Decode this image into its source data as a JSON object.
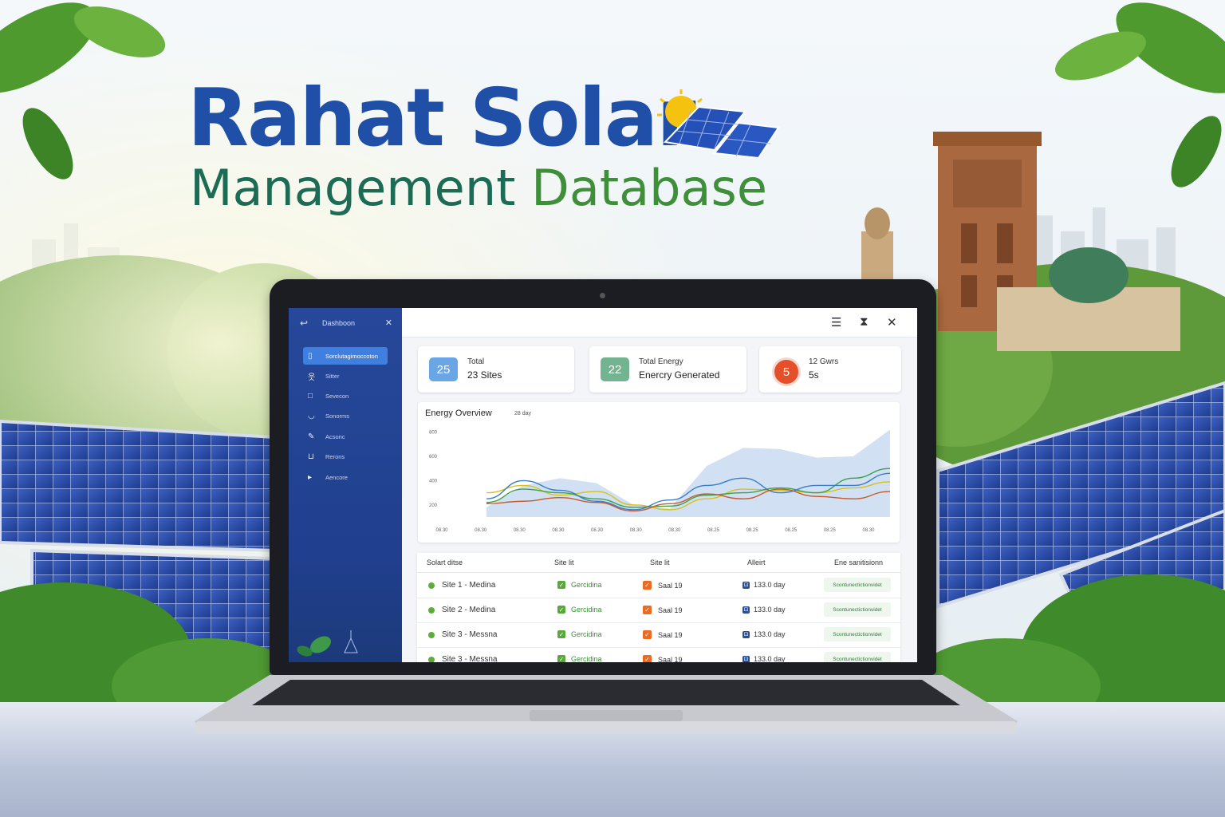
{
  "header": {
    "title_line1": "Rahat Solar",
    "title_line2_part1": "Management",
    "title_line2_part2": "Database"
  },
  "sidebar": {
    "app_name": "Dashboon",
    "items": [
      {
        "label": "Sorclutagimoccoton",
        "icon": "dashboard-icon",
        "active": true
      },
      {
        "label": "Sitter",
        "icon": "user-icon"
      },
      {
        "label": "Sevecon",
        "icon": "square-icon"
      },
      {
        "label": "Sonorms",
        "icon": "shield-icon"
      },
      {
        "label": "Acsonc",
        "icon": "edit-icon"
      },
      {
        "label": "Rerons",
        "icon": "document-icon"
      },
      {
        "label": "Aencore",
        "icon": "play-icon"
      }
    ]
  },
  "cards": [
    {
      "number": "25",
      "line1": "Total",
      "line2": "23 Sites",
      "color": "#6aa6e6"
    },
    {
      "number": "22",
      "line1": "Total Energy",
      "line2": "Enercry Generated",
      "color": "#74b38f"
    },
    {
      "number": "5",
      "line1": "12 Gwrs",
      "line2": "5s",
      "color": "#e5502a"
    }
  ],
  "chart_panel": {
    "title": "Energy Overview",
    "subtitle": "28 day"
  },
  "chart_data": {
    "type": "line",
    "x": [
      "08.30",
      "08.30",
      "08.30",
      "08.30",
      "08.30",
      "08.30",
      "08.30",
      "08.25",
      "08.25",
      "08.25",
      "08.25",
      "08.30"
    ],
    "y_ticks": [
      200,
      400,
      600,
      800
    ],
    "ylim": [
      100,
      850
    ],
    "area": [
      180,
      360,
      420,
      380,
      200,
      170,
      520,
      670,
      660,
      590,
      600,
      820
    ],
    "series": [
      {
        "color": "#d7c11c",
        "values": [
          300,
          360,
          280,
          310,
          200,
          160,
          250,
          330,
          320,
          300,
          340,
          390
        ]
      },
      {
        "color": "#3aa24a",
        "values": [
          220,
          330,
          300,
          250,
          180,
          190,
          280,
          300,
          340,
          300,
          420,
          500
        ]
      },
      {
        "color": "#3a7ec9",
        "values": [
          250,
          400,
          320,
          230,
          160,
          240,
          360,
          420,
          300,
          360,
          360,
          460
        ]
      },
      {
        "color": "#c45a2e",
        "values": [
          210,
          230,
          260,
          220,
          150,
          210,
          290,
          250,
          330,
          270,
          250,
          310
        ]
      }
    ]
  },
  "table": {
    "headers": [
      "Solart ditse",
      "Site lit",
      "Site lit",
      "Alleirt",
      "Ene sanitisionn"
    ],
    "rows": [
      {
        "site": "Site 1 - Medina",
        "status": "Gercidina",
        "slot": "Saal 19",
        "alert": "133.0 day",
        "tag": "Scontunectictionvidet"
      },
      {
        "site": "Site 2 - Medina",
        "status": "Gercidina",
        "slot": "Saal 19",
        "alert": "133.0 day",
        "tag": "Scontunectictionvidet"
      },
      {
        "site": "Site 3 - Messna",
        "status": "Gercidina",
        "slot": "Saal 19",
        "alert": "133.0 day",
        "tag": "Scontunectictionvidet"
      },
      {
        "site": "Site 3 - Messna",
        "status": "Gercidina",
        "slot": "Saal 19",
        "alert": "133.0 day",
        "tag": "Scontunectictionvidet"
      }
    ]
  }
}
